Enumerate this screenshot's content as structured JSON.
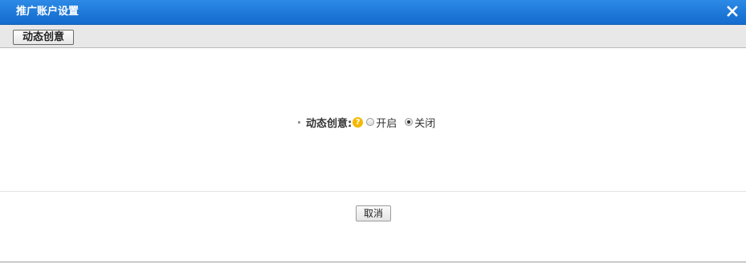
{
  "dialog": {
    "title": "推广账户设置",
    "close_icon": "close-icon"
  },
  "tabs": [
    {
      "label": "动态创意"
    }
  ],
  "form": {
    "field_label": "动态创意:",
    "help_icon": "question-icon",
    "help_glyph": "?",
    "options": [
      {
        "label": "开启",
        "checked": false
      },
      {
        "label": "关闭",
        "checked": true
      }
    ]
  },
  "footer": {
    "cancel_label": "取消"
  },
  "colors": {
    "titlebar": "#1d78d8",
    "help_icon": "#f5b800"
  }
}
